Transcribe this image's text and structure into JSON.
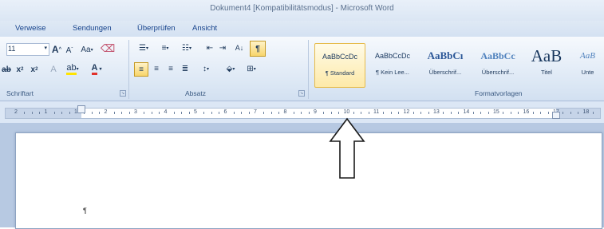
{
  "window": {
    "title": "Dokument4 [Kompatibilitätsmodus] - Microsoft Word"
  },
  "tabs": [
    "Verweise",
    "Sendungen",
    "Überprüfen",
    "Ansicht"
  ],
  "font_group": {
    "size_value": "11",
    "grow_label": "A",
    "shrink_label": "A",
    "case_label": "Aa",
    "subscript_label": "x",
    "superscript_label": "x",
    "fontcolor_label": "A",
    "label": "Schriftart"
  },
  "paragraph_group": {
    "label": "Absatz",
    "pilcrow_label": "¶"
  },
  "styles_group": {
    "label": "Formatvorlagen",
    "styles": [
      {
        "sample": "AaBbCcDc",
        "name": "¶ Standard"
      },
      {
        "sample": "AaBbCcDc",
        "name": "¶ Kein Lee..."
      },
      {
        "sample": "AaBbCı",
        "name": "Überschrif..."
      },
      {
        "sample": "AaBbCc",
        "name": "Überschrif..."
      },
      {
        "sample": "AaB",
        "name": "Titel"
      },
      {
        "sample": "AaB",
        "name": "Unte"
      }
    ]
  },
  "ruler": {
    "numbers": [
      "2",
      "1",
      "1",
      "2",
      "3",
      "4",
      "5",
      "6",
      "7",
      "8",
      "9",
      "10",
      "11",
      "12",
      "13",
      "14",
      "15",
      "16",
      "17",
      "18"
    ]
  },
  "document": {
    "pilcrow": "¶"
  },
  "colors": {
    "accent": "#15428b",
    "ribbon": "#dde8f5",
    "highlight_yellow": "#e6bb4b"
  },
  "icons": [
    "text-highlight-icon",
    "font-color-icon",
    "bullets-icon",
    "numbering-icon",
    "multilevel-list-icon",
    "decrease-indent-icon",
    "increase-indent-icon",
    "sort-icon",
    "show-formatting-icon",
    "align-left-icon",
    "align-center-icon",
    "align-right-icon",
    "justify-icon",
    "line-spacing-icon",
    "shading-icon",
    "borders-icon",
    "clear-formatting-icon",
    "annotation-arrow-icon"
  ]
}
